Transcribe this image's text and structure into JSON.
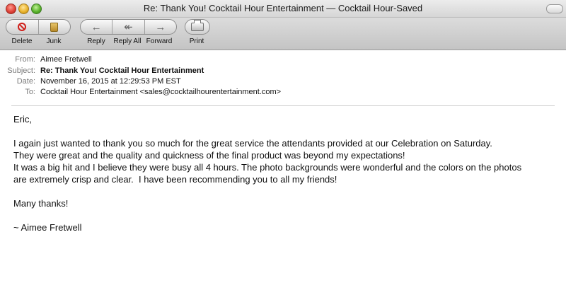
{
  "window": {
    "title": "Re: Thank You! Cocktail Hour Entertainment — Cocktail Hour-Saved"
  },
  "toolbar": {
    "delete_label": "Delete",
    "junk_label": "Junk",
    "reply_label": "Reply",
    "reply_all_label": "Reply All",
    "forward_label": "Forward",
    "print_label": "Print"
  },
  "headers": {
    "from_label": "From:",
    "from_value": "Aimee Fretwell",
    "subject_label": "Subject:",
    "subject_value": "Re: Thank You! Cocktail Hour Entertainment",
    "date_label": "Date:",
    "date_value": "November 16, 2015 at 12:29:53 PM EST",
    "to_label": "To:",
    "to_value": "Cocktail Hour Entertainment <sales@cocktailhourentertainment.com>"
  },
  "message": {
    "greeting": "Eric,",
    "line1": "I again just wanted to thank you so much for the great service the attendants provided at our Celebration on Saturday.",
    "line2": "They were great and the quality and quickness of the final product was beyond my expectations!",
    "line3": "It was a big hit and I believe they were busy all 4 hours. The photo backgrounds were wonderful and the colors on the photos",
    "line4": "are extremely crisp and clear.  I have been recommending you to all my friends!",
    "closing": "Many thanks!",
    "signature": "~ Aimee Fretwell"
  },
  "icons": {
    "delete": "delete-icon",
    "junk": "junk-icon",
    "reply": "reply-arrow-icon",
    "reply_all": "reply-all-arrow-icon",
    "forward": "forward-arrow-icon",
    "print": "printer-icon"
  }
}
